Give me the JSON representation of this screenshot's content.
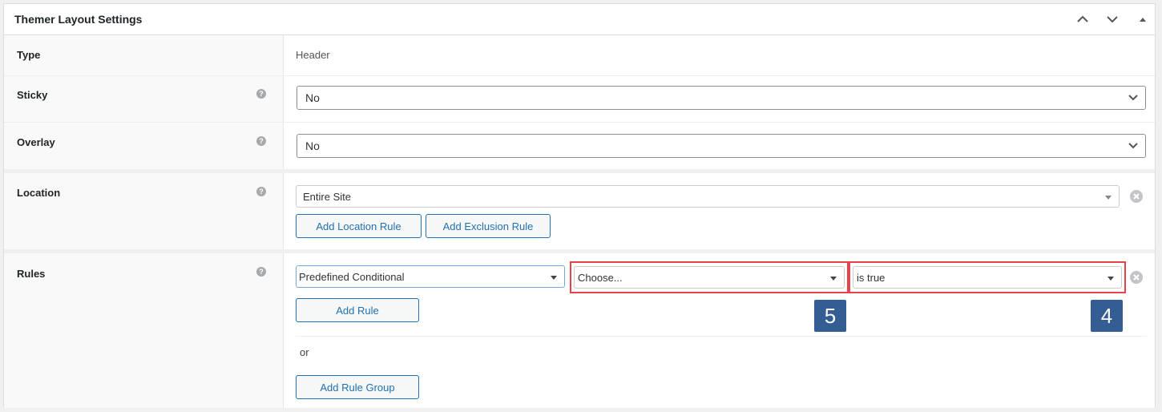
{
  "panel": {
    "title": "Themer Layout Settings",
    "header_buttons": [
      "move-up",
      "move-down",
      "toggle-panel"
    ]
  },
  "rows": {
    "type": {
      "label": "Type",
      "value": "Header"
    },
    "sticky": {
      "label": "Sticky",
      "value": "No",
      "help": "help-icon"
    },
    "overlay": {
      "label": "Overlay",
      "value": "No",
      "help": "help-icon"
    },
    "location": {
      "label": "Location",
      "value": "Entire Site",
      "add_location_rule": "Add Location Rule",
      "add_exclusion_rule": "Add Exclusion Rule"
    },
    "rules": {
      "label": "Rules",
      "condition_type": "Predefined Conditional",
      "condition": "Choose...",
      "operator": "is true",
      "add_rule": "Add Rule",
      "or_text": "or",
      "add_rule_group": "Add Rule Group"
    }
  },
  "annotations": {
    "badge_condition": "5",
    "badge_operator": "4",
    "highlight_color": "#e8434a",
    "badge_color": "#345d94"
  }
}
